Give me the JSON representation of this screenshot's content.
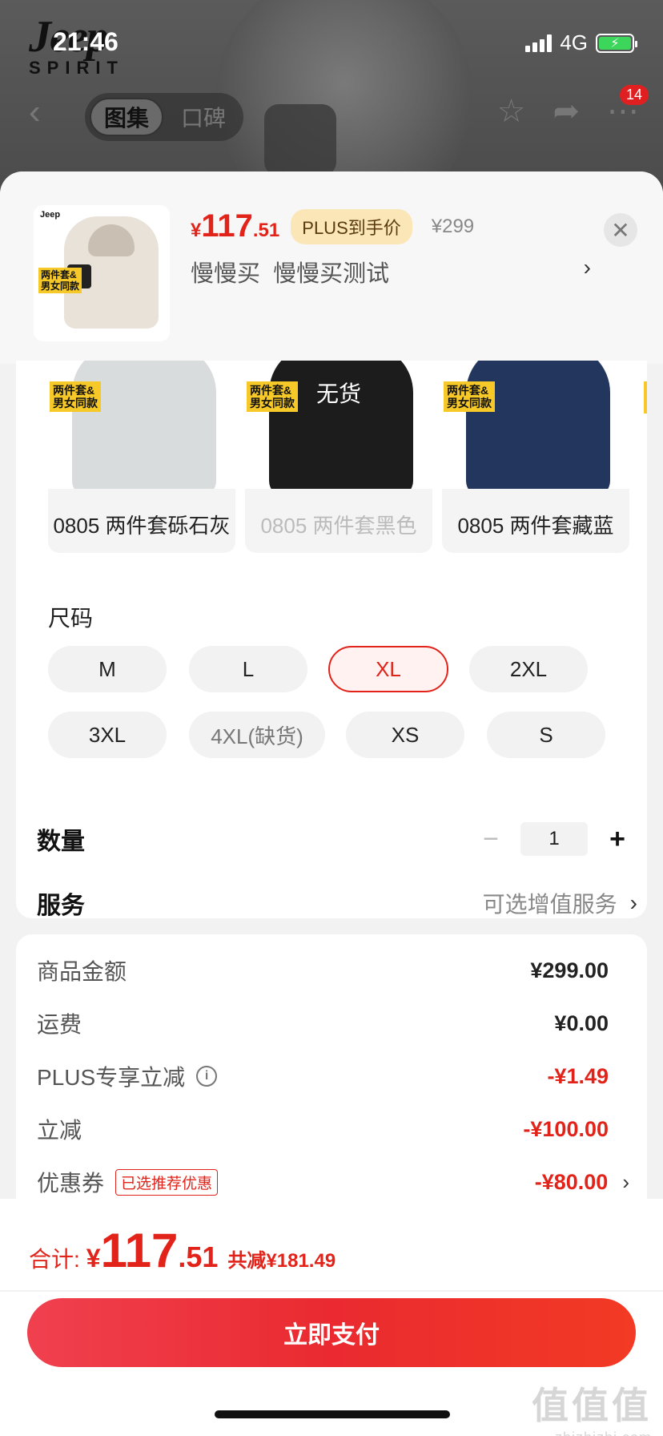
{
  "status": {
    "time": "21:46",
    "network": "4G"
  },
  "background_page": {
    "brand_top": "Jeep",
    "brand_bottom": "SPIRIT",
    "tabs": [
      "图集",
      "口碑"
    ],
    "cart_badge": "14"
  },
  "product": {
    "price_currency": "¥",
    "price_int": "117",
    "price_dec": ".51",
    "plus_label": "PLUS到手价",
    "original_price": "¥299",
    "shop_text": "慢慢买  慢慢买测试",
    "thumb_brand": "Jeep\nSPIRIT",
    "thumb_tag": "两件套&\n男女同款"
  },
  "colors": [
    {
      "label": "0805 两件套砾石灰",
      "tag": "两件套&\n男女同款",
      "disabled": false,
      "coat_color": "#d8dcdd"
    },
    {
      "label": "0805 两件套黑色",
      "tag": "两件套&\n男女同款",
      "disabled": true,
      "oos": "无货",
      "coat_color": "#1c1c1c"
    },
    {
      "label": "0805 两件套藏蓝",
      "tag": "两件套&\n男女同款",
      "disabled": false,
      "coat_color": "#23365e"
    }
  ],
  "sizes": {
    "title": "尺码",
    "options": [
      "M",
      "L",
      "XL",
      "2XL",
      "3XL",
      "4XL(缺货)",
      "XS",
      "S"
    ],
    "selected": "XL"
  },
  "quantity": {
    "label": "数量",
    "value": "1",
    "minus": "−",
    "plus": "+"
  },
  "service": {
    "label": "服务",
    "value": "可选增值服务"
  },
  "price_breakdown": [
    {
      "label": "商品金额",
      "value": "¥299.00",
      "red": false
    },
    {
      "label": "运费",
      "value": "¥0.00",
      "red": false
    },
    {
      "label": "PLUS专享立减",
      "value": "-¥1.49",
      "red": true,
      "info": true
    },
    {
      "label": "立减",
      "value": "-¥100.00",
      "red": true
    },
    {
      "label": "优惠券",
      "value": "-¥80.00",
      "red": true,
      "tag": "已选推荐优惠"
    }
  ],
  "footer": {
    "total_label": "合计:",
    "total_currency": "¥",
    "total_int": "117",
    "total_dec": ".51",
    "saved": "共减¥181.49",
    "pay_button": "立即支付"
  },
  "watermark": {
    "main": "值值值",
    "site": "zhizhizhi.com"
  },
  "colors_theme": {
    "accent": "#e2231a",
    "plus_pill_bg": "#fbe6b8"
  }
}
